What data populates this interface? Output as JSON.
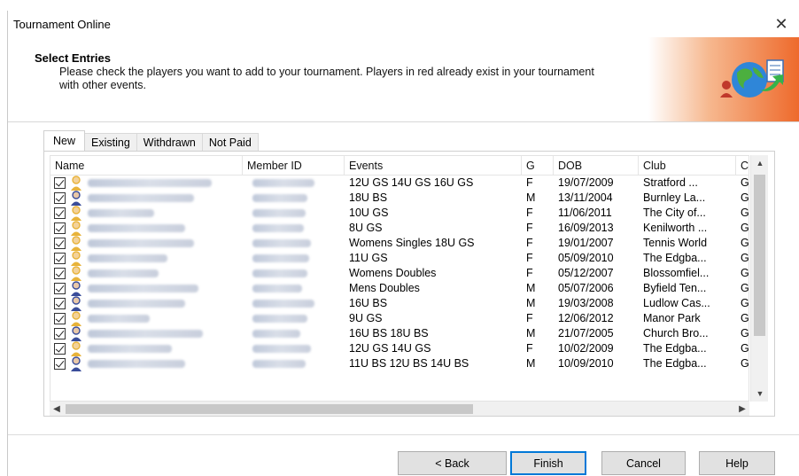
{
  "window": {
    "title": "Tournament Online",
    "close_glyph": "✕"
  },
  "header": {
    "title": "Select Entries",
    "description": "Please check the players you want to add to your tournament. Players in red already exist in your tournament with other events.",
    "logo_icon": "globe-transfer-icon"
  },
  "tabs": [
    {
      "label": "New",
      "active": true
    },
    {
      "label": "Existing",
      "active": false
    },
    {
      "label": "Withdrawn",
      "active": false
    },
    {
      "label": "Not Paid",
      "active": false
    }
  ],
  "columns": {
    "name": "Name",
    "member_id": "Member ID",
    "events": "Events",
    "g": "G",
    "dob": "DOB",
    "club": "Club",
    "c": "C"
  },
  "rows": [
    {
      "checked": true,
      "gender": "F",
      "events": "12U GS 14U GS 16U GS",
      "dob": "19/07/2009",
      "club": "Stratford ...",
      "c": "G"
    },
    {
      "checked": true,
      "gender": "M",
      "events": "18U BS",
      "dob": "13/11/2004",
      "club": "Burnley La...",
      "c": "G"
    },
    {
      "checked": true,
      "gender": "F",
      "events": "10U GS",
      "dob": "11/06/2011",
      "club": "The City of...",
      "c": "G"
    },
    {
      "checked": true,
      "gender": "F",
      "events": "8U GS",
      "dob": "16/09/2013",
      "club": "Kenilworth ...",
      "c": "G"
    },
    {
      "checked": true,
      "gender": "F",
      "events": "Womens Singles 18U GS",
      "dob": "19/01/2007",
      "club": "Tennis World",
      "c": "G"
    },
    {
      "checked": true,
      "gender": "F",
      "events": "11U GS",
      "dob": "05/09/2010",
      "club": "The Edgba...",
      "c": "G"
    },
    {
      "checked": true,
      "gender": "F",
      "events": "Womens Doubles",
      "dob": "05/12/2007",
      "club": "Blossomfiel...",
      "c": "G"
    },
    {
      "checked": true,
      "gender": "M",
      "events": "Mens Doubles",
      "dob": "05/07/2006",
      "club": "Byfield Ten...",
      "c": "G"
    },
    {
      "checked": true,
      "gender": "M",
      "events": "16U BS",
      "dob": "19/03/2008",
      "club": "Ludlow Cas...",
      "c": "G"
    },
    {
      "checked": true,
      "gender": "F",
      "events": "9U GS",
      "dob": "12/06/2012",
      "club": "Manor Park",
      "c": "G"
    },
    {
      "checked": true,
      "gender": "M",
      "events": "16U BS 18U BS",
      "dob": "21/07/2005",
      "club": "Church Bro...",
      "c": "G"
    },
    {
      "checked": true,
      "gender": "F",
      "events": "12U GS 14U GS",
      "dob": "10/02/2009",
      "club": "The Edgba...",
      "c": "G"
    },
    {
      "checked": true,
      "gender": "M",
      "events": "11U BS 12U BS 14U BS",
      "dob": "10/09/2010",
      "club": "The Edgba...",
      "c": "G"
    }
  ],
  "buttons": {
    "back": "< Back",
    "finish": "Finish",
    "cancel": "Cancel",
    "help": "Help"
  },
  "colors": {
    "accent": "#ee6a2c",
    "female_avatar": "#e8b33a",
    "male_avatar": "#3a4d9a",
    "default_button_border": "#0078d7"
  }
}
